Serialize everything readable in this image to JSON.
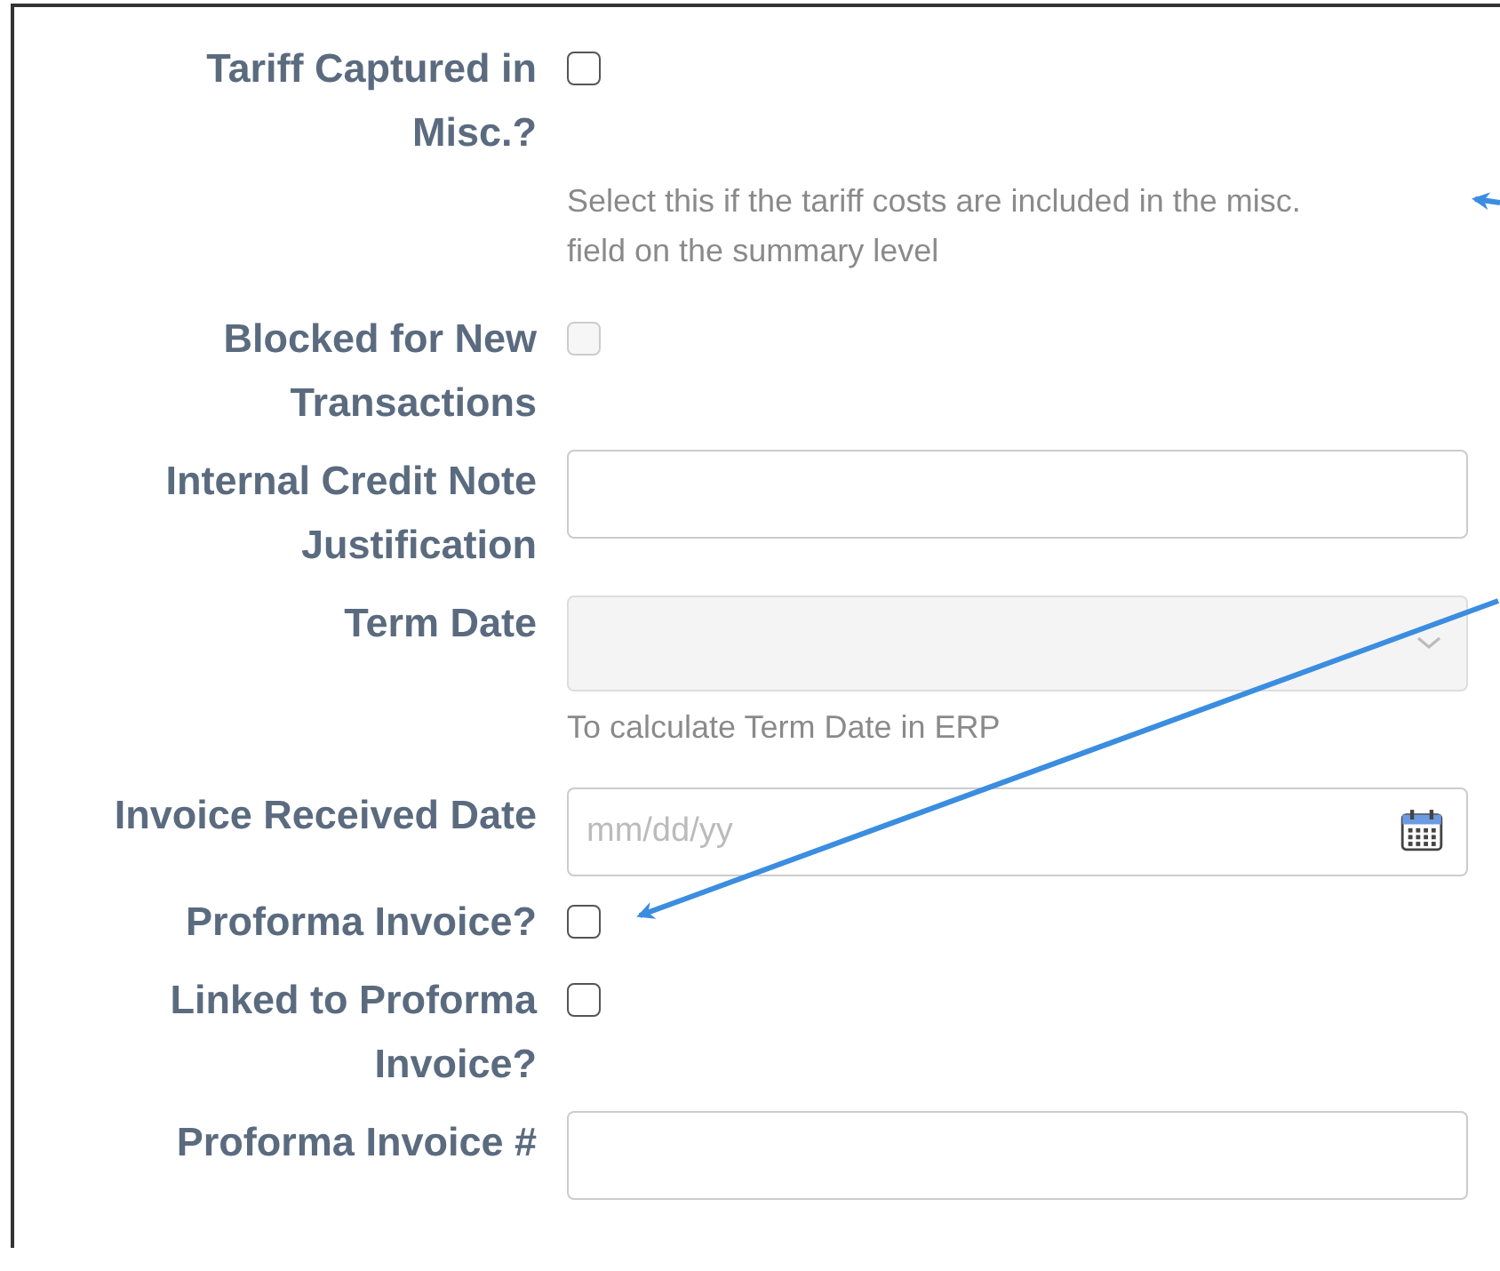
{
  "fields": [
    {
      "kind": "checkbox",
      "label": "Tariff Captured in Misc.?",
      "checked": false,
      "disabled": false,
      "help": "Select this if the tariff costs are included in the misc. field on the summary level"
    },
    {
      "kind": "checkbox",
      "label": "Blocked for New Transactions",
      "checked": false,
      "disabled": true
    },
    {
      "kind": "text",
      "label": "Internal Credit Note Justification",
      "disabled": false
    },
    {
      "kind": "select",
      "label": "Term Date",
      "disabled": true,
      "help": "To calculate Term Date in ERP"
    },
    {
      "kind": "date",
      "label": "Invoice Received Date",
      "placeholder": "mm/dd/yy",
      "disabled": false
    },
    {
      "kind": "checkbox",
      "label": "Proforma Invoice?",
      "checked": false,
      "disabled": false
    },
    {
      "kind": "checkbox",
      "label": "Linked to Proforma Invoice?",
      "checked": false,
      "disabled": false
    },
    {
      "kind": "text",
      "label": "Proforma Invoice #",
      "disabled": false
    }
  ]
}
